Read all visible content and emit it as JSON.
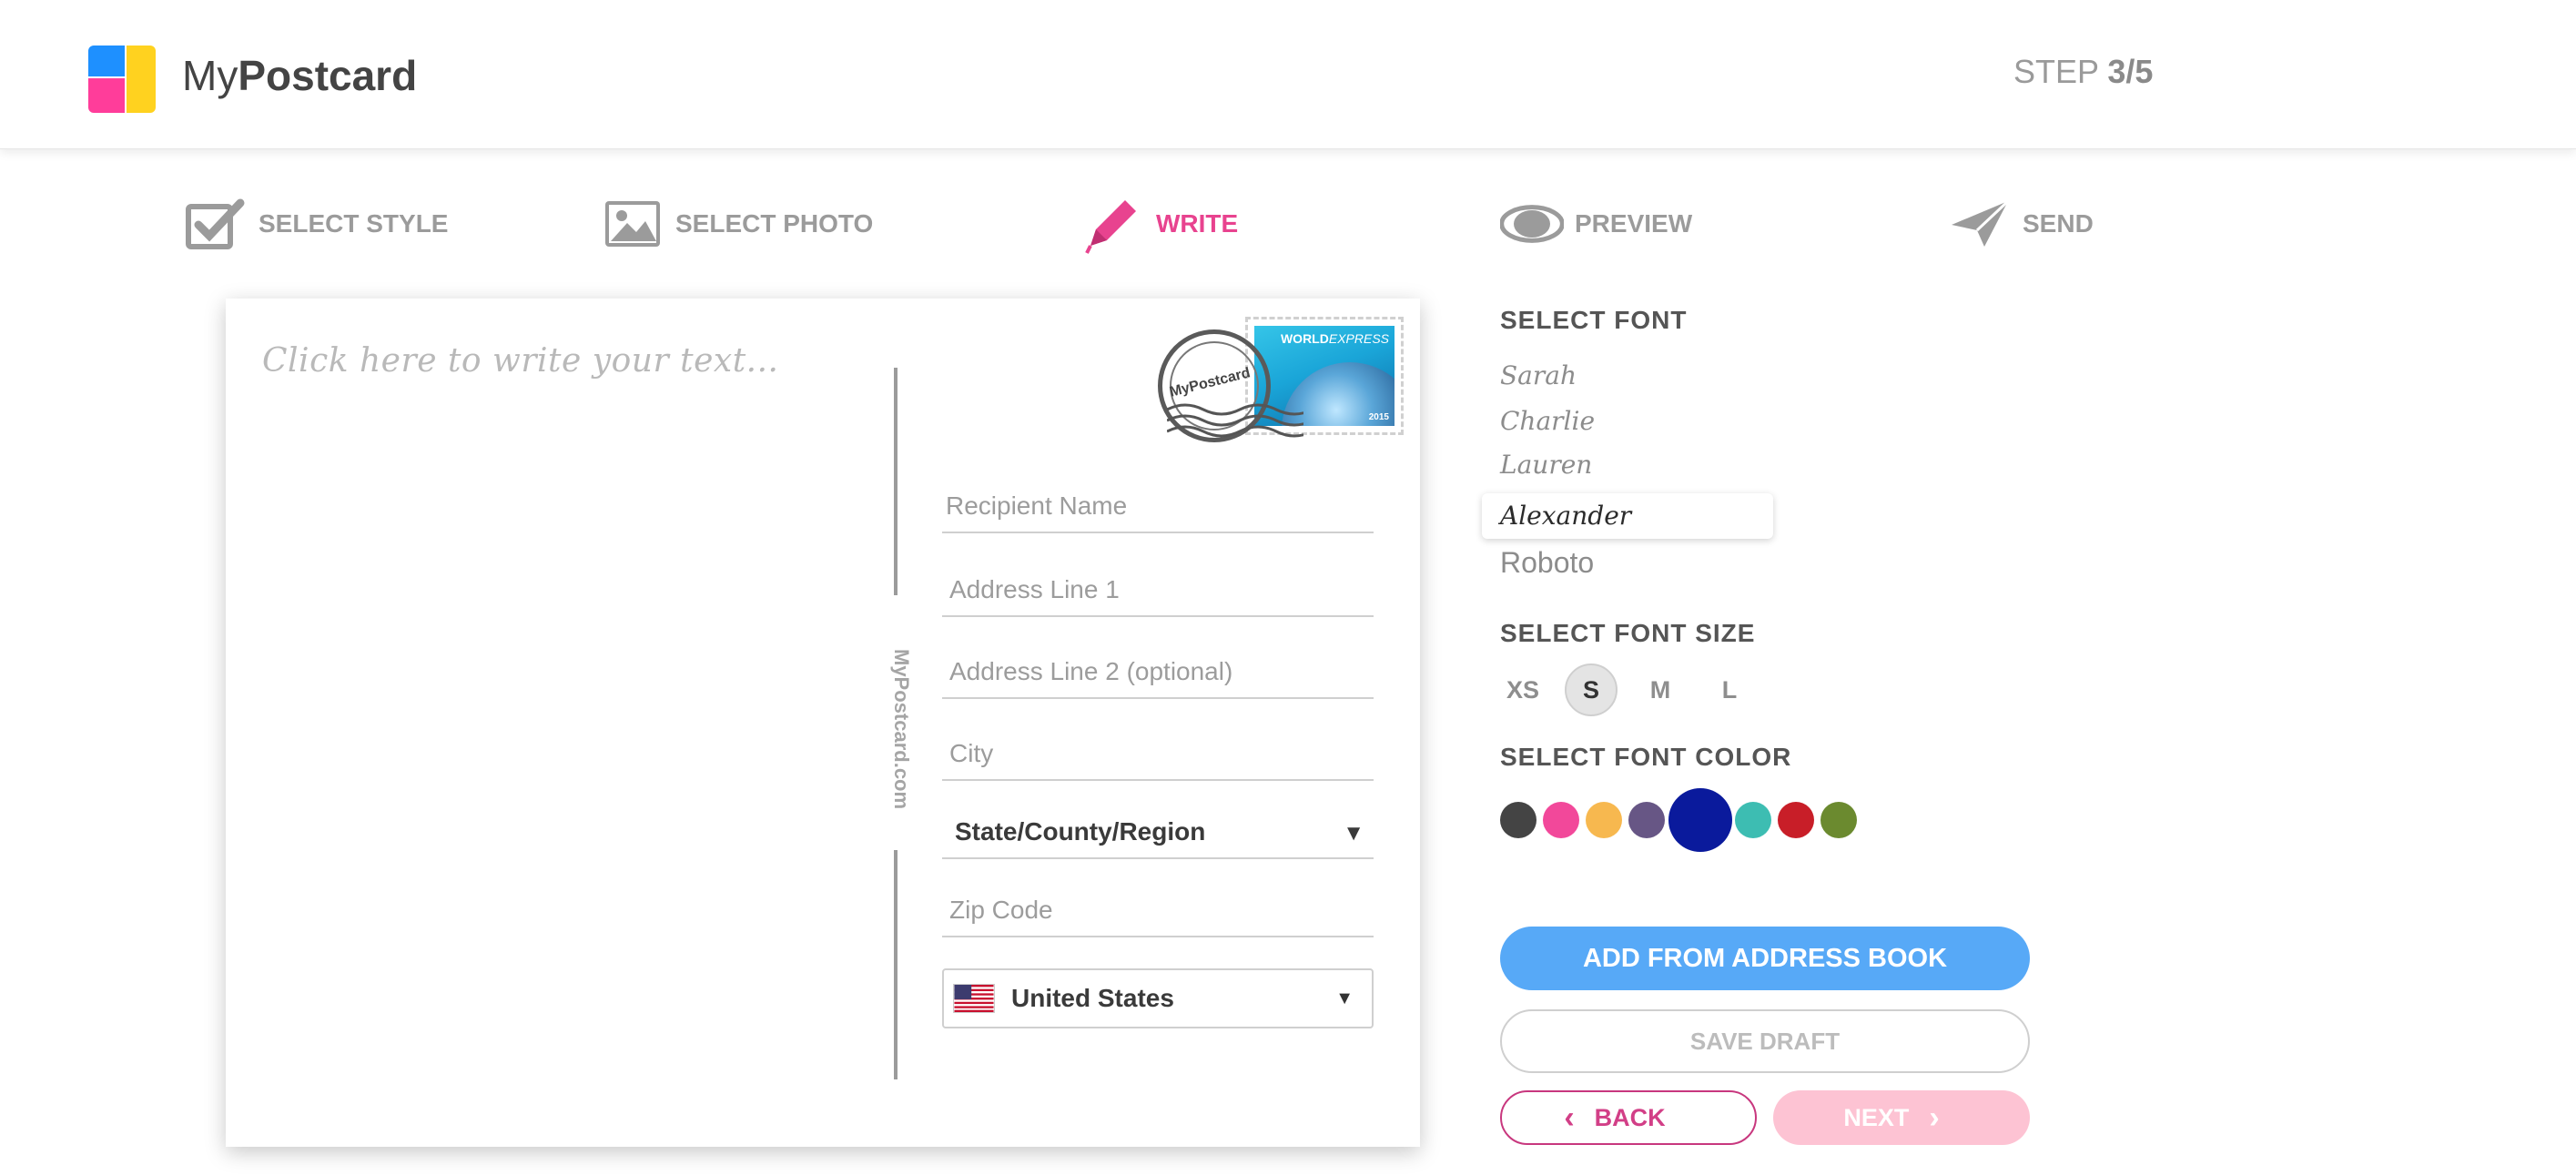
{
  "header": {
    "brand_light": "My",
    "brand_bold": "Postcard",
    "step_prefix": "STEP ",
    "step_value": "3/5"
  },
  "steps": [
    {
      "label": "SELECT STYLE",
      "icon": "checkbox-icon"
    },
    {
      "label": "SELECT PHOTO",
      "icon": "photo-icon"
    },
    {
      "label": "WRITE",
      "icon": "pencil-icon",
      "active": true
    },
    {
      "label": "PREVIEW",
      "icon": "eye-icon"
    },
    {
      "label": "SEND",
      "icon": "paper-plane-icon"
    }
  ],
  "postcard": {
    "message_placeholder": "Click here to write your text...",
    "vertical_brand": "MyPostcard.com",
    "stamp_title": "WORLD",
    "stamp_title_italic": "EXPRESS",
    "stamp_year": "2015",
    "postmark_text": "MyPostcard",
    "recipient_name": "Recipient Name",
    "address_line_1": "Address Line 1",
    "address_line_2": "Address Line 2 (optional)",
    "city": "City",
    "state_select": "State/County/Region",
    "state_arrow": "▼",
    "zip": "Zip Code",
    "country": "United States",
    "country_arrow": "▼"
  },
  "font_panel": {
    "select_font_title": "SELECT FONT",
    "fonts": [
      "Sarah",
      "Charlie",
      "Lauren",
      "Alexander",
      "Roboto"
    ],
    "selected_font": "Alexander",
    "select_size_title": "SELECT FONT SIZE",
    "sizes": [
      "XS",
      "S",
      "M",
      "L"
    ],
    "selected_size": "S",
    "select_color_title": "SELECT FONT COLOR",
    "colors": [
      "#444444",
      "#f2489a",
      "#f7b84f",
      "#675685",
      "#0a1a9c",
      "#3dbdb2",
      "#c81e28",
      "#6b8a2f"
    ],
    "selected_color": "#0a1a9c"
  },
  "buttons": {
    "add_from_address_book": "ADD FROM ADDRESS BOOK",
    "save_draft": "SAVE DRAFT",
    "back": "BACK",
    "next": "NEXT"
  }
}
